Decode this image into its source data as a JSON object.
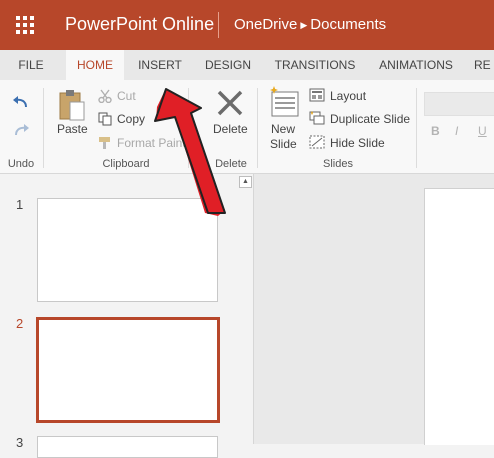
{
  "app": {
    "name": "PowerPoint Online",
    "breadcrumb": [
      "OneDrive",
      "Documents"
    ]
  },
  "tabs": [
    "FILE",
    "HOME",
    "INSERT",
    "DESIGN",
    "TRANSITIONS",
    "ANIMATIONS",
    "RE"
  ],
  "active_tab": "HOME",
  "ribbon": {
    "undo_group": "Undo",
    "clipboard": {
      "paste": "Paste",
      "cut": "Cut",
      "copy": "Copy",
      "format_painter": "Format Paint",
      "label": "Clipboard"
    },
    "delete": {
      "button": "Delete",
      "label": "Delete"
    },
    "slides": {
      "new_slide_line1": "New",
      "new_slide_line2": "Slide",
      "layout": "Layout",
      "duplicate": "Duplicate Slide",
      "hide": "Hide Slide",
      "label": "Slides"
    },
    "font_buttons": [
      "B",
      "I",
      "U"
    ]
  },
  "slides": {
    "numbers": [
      "1",
      "2",
      "3"
    ],
    "selected": "2"
  },
  "colors": {
    "accent": "#b7472a",
    "arrow": "#e01f26"
  },
  "icons": [
    "app-launcher-icon",
    "undo-icon",
    "redo-icon",
    "paste-icon",
    "cut-icon",
    "copy-icon",
    "format-painter-icon",
    "delete-icon",
    "new-slide-icon",
    "layout-icon",
    "duplicate-slide-icon",
    "hide-slide-icon",
    "annotation-arrow"
  ]
}
